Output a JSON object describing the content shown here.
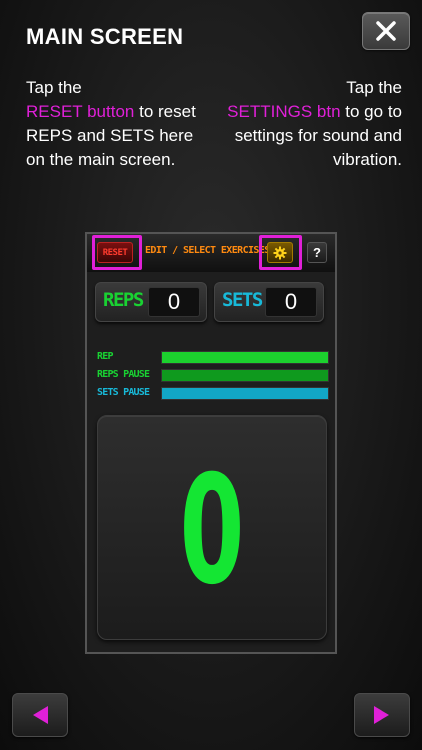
{
  "header": {
    "title": "MAIN SCREEN",
    "close_icon": "close-icon"
  },
  "instructions": {
    "left": {
      "line1": "Tap the",
      "highlight": "RESET button",
      "line2": "to reset REPS and SETS here on the main screen."
    },
    "right": {
      "line1": "Tap the",
      "highlight": "SETTINGS btn",
      "line2": "to go to settings for sound and vibration."
    },
    "highlight_color": "#e020d8"
  },
  "app_preview": {
    "reset_label": "RESET",
    "edit_label": "EDIT / SELECT EXERCISES",
    "settings_icon": "gear-icon",
    "help_label": "?",
    "reps": {
      "label": "REPS",
      "value": "0",
      "color": "#19d232"
    },
    "sets": {
      "label": "SETS",
      "value": "0",
      "color": "#18b9d8"
    },
    "bars": [
      {
        "label": "REP",
        "label_color": "#19d232",
        "fill_color": "#1cd12e",
        "level": 1.0
      },
      {
        "label": "REPS PAUSE",
        "label_color": "#19d232",
        "fill_color": "#0f9a1e",
        "level": 1.0
      },
      {
        "label": "SETS PAUSE",
        "label_color": "#18b9d8",
        "fill_color": "#12a7c6",
        "level": 1.0
      }
    ],
    "big_counter": "0",
    "big_counter_color": "#14e633"
  },
  "navigation": {
    "prev_icon": "triangle-left-icon",
    "next_icon": "triangle-right-icon",
    "arrow_color": "#e020d8"
  }
}
